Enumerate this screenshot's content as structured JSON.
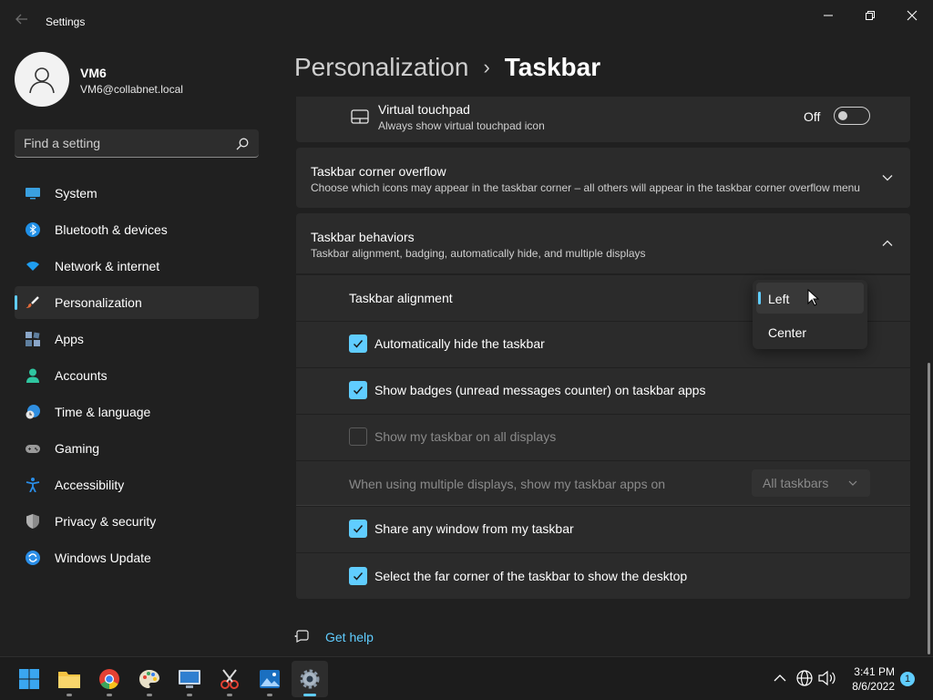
{
  "window": {
    "title": "Settings",
    "controls": {
      "minimize": "minimize",
      "maximize": "restore",
      "close": "close"
    }
  },
  "user": {
    "name": "VM6",
    "email": "VM6@collabnet.local"
  },
  "search": {
    "placeholder": "Find a setting"
  },
  "sidebar": {
    "items": [
      {
        "label": "System",
        "icon": "monitor-icon",
        "active": false
      },
      {
        "label": "Bluetooth & devices",
        "icon": "bluetooth-icon",
        "active": false
      },
      {
        "label": "Network & internet",
        "icon": "wifi-icon",
        "active": false
      },
      {
        "label": "Personalization",
        "icon": "brush-icon",
        "active": true
      },
      {
        "label": "Apps",
        "icon": "apps-icon",
        "active": false
      },
      {
        "label": "Accounts",
        "icon": "person-icon",
        "active": false
      },
      {
        "label": "Time & language",
        "icon": "clock-globe-icon",
        "active": false
      },
      {
        "label": "Gaming",
        "icon": "gamepad-icon",
        "active": false
      },
      {
        "label": "Accessibility",
        "icon": "accessibility-icon",
        "active": false
      },
      {
        "label": "Privacy & security",
        "icon": "shield-icon",
        "active": false
      },
      {
        "label": "Windows Update",
        "icon": "refresh-icon",
        "active": false
      }
    ]
  },
  "header": {
    "parent": "Personalization",
    "separator": "›",
    "current": "Taskbar"
  },
  "content": {
    "virtual_touchpad": {
      "title": "Virtual touchpad",
      "subtitle": "Always show virtual touchpad icon",
      "toggle_state": "Off"
    },
    "corner_overflow": {
      "title": "Taskbar corner overflow",
      "subtitle": "Choose which icons may appear in the taskbar corner – all others will appear in the taskbar corner overflow menu"
    },
    "behaviors": {
      "title": "Taskbar behaviors",
      "subtitle": "Taskbar alignment, badging, automatically hide, and multiple displays",
      "alignment_label": "Taskbar alignment",
      "alignment_options": [
        "Left",
        "Center"
      ],
      "alignment_selected": "Left",
      "auto_hide": {
        "label": "Automatically hide the taskbar",
        "checked": true
      },
      "badges": {
        "label": "Show badges (unread messages counter) on taskbar apps",
        "checked": true
      },
      "all_displays": {
        "label": "Show my taskbar on all displays",
        "checked": false
      },
      "multi_display": {
        "label": "When using multiple displays, show my taskbar apps on",
        "value": "All taskbars"
      },
      "share_window": {
        "label": "Share any window from my taskbar",
        "checked": true
      },
      "far_corner": {
        "label": "Select the far corner of the taskbar to show the desktop",
        "checked": true
      }
    },
    "get_help": "Get help"
  },
  "taskbar": {
    "apps": [
      "start-icon",
      "file-explorer-icon",
      "chrome-icon",
      "paint-icon",
      "remote-desktop-icon",
      "snipping-icon",
      "photos-icon",
      "settings-icon"
    ],
    "clock": {
      "time": "3:41 PM",
      "date": "8/6/2022"
    },
    "notification_count": "1"
  },
  "colors": {
    "accent": "#60cdff",
    "background": "#202020",
    "card": "#2b2b2b"
  }
}
